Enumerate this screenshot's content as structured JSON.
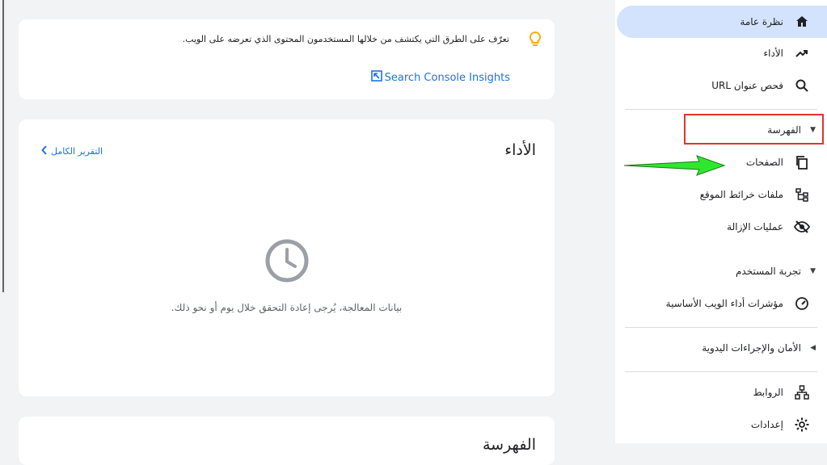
{
  "sidebar": {
    "overview": {
      "label": "نظرة عامة",
      "icon": "home-icon"
    },
    "performance": {
      "label": "الأداء",
      "icon": "trending-up-icon"
    },
    "url_inspection": {
      "label": "فحص عنوان URL",
      "icon": "search-icon"
    },
    "indexing_section": {
      "label": "الفهرسة"
    },
    "pages": {
      "label": "الصفحات",
      "icon": "pages-icon"
    },
    "sitemaps": {
      "label": "ملفات خرائط الموقع",
      "icon": "sitemap-icon"
    },
    "removals": {
      "label": "عمليات الإزالة",
      "icon": "eye-off-icon"
    },
    "experience_section": {
      "label": "تجربة المستخدم"
    },
    "core_web_vitals": {
      "label": "مؤشرات أداء الويب الأساسية",
      "icon": "gauge-icon"
    },
    "security_section": {
      "label": "الأمان والإجراءات اليدوية"
    },
    "links": {
      "label": "الروابط",
      "icon": "links-icon"
    },
    "settings": {
      "label": "إعدادات",
      "icon": "gear-icon"
    }
  },
  "insights_card": {
    "text": "تعرّف على الطرق التي يكتشف من خلالها المستخدمون المحتوى الذي تعرضه على الويب.",
    "link_label": "Search Console Insights"
  },
  "performance_card": {
    "title": "الأداء",
    "full_report_label": "التقرير الكامل",
    "processing_message": "بيانات المعالجة، يُرجى إعادة التحقق خلال يوم أو نحو ذلك."
  },
  "third_card": {
    "title": "الفهرسة"
  },
  "colors": {
    "accent": "#1a73e8",
    "active_bg": "#d3e3fd",
    "highlight_border": "#e0342f",
    "arrow_green": "#2ee82e"
  }
}
